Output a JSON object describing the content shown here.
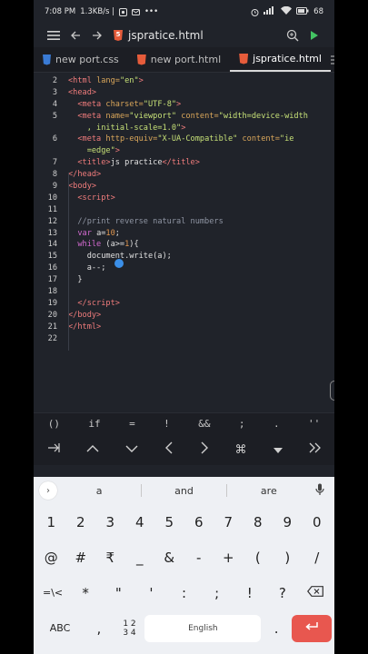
{
  "status": {
    "time": "7:08 PM",
    "speed": "1.3KB/s",
    "battery": "68"
  },
  "appbar": {
    "menu_icon": "hamburger-icon",
    "filename": "jspratice.html",
    "file_icon_label": "5"
  },
  "tabs": [
    {
      "label": "new port.css"
    },
    {
      "label": "new port.html"
    },
    {
      "label": "jspratice.html"
    }
  ],
  "code_lines": [
    {
      "n": "2"
    },
    {
      "n": "3"
    },
    {
      "n": "4"
    },
    {
      "n": "5"
    },
    {
      "n": ""
    },
    {
      "n": "6"
    },
    {
      "n": ""
    },
    {
      "n": "7"
    },
    {
      "n": "8"
    },
    {
      "n": "9"
    },
    {
      "n": "10"
    },
    {
      "n": "11"
    },
    {
      "n": "12"
    },
    {
      "n": "13"
    },
    {
      "n": "14"
    },
    {
      "n": "15"
    },
    {
      "n": "16"
    },
    {
      "n": "17"
    },
    {
      "n": "18"
    },
    {
      "n": "19"
    },
    {
      "n": "20"
    },
    {
      "n": "21"
    },
    {
      "n": "22"
    }
  ],
  "symbols": [
    "()",
    "if",
    "=",
    "!",
    "&&",
    ";",
    ".",
    "''"
  ],
  "keyboard": {
    "suggestions": [
      "a",
      "and",
      "are"
    ],
    "row_numbers": [
      "1",
      "2",
      "3",
      "4",
      "5",
      "6",
      "7",
      "8",
      "9",
      "0"
    ],
    "row_symbols1": [
      "@",
      "#",
      "₹",
      "_",
      "&",
      "-",
      "+",
      "(",
      ")",
      "/"
    ],
    "row_symbols2": [
      "=\\<",
      "*",
      "\"",
      "'",
      ":",
      ";",
      "!",
      "?"
    ],
    "abc": "ABC",
    "comma": ",",
    "numpad": "1 2\n3 4",
    "space": "English",
    "period": "."
  }
}
